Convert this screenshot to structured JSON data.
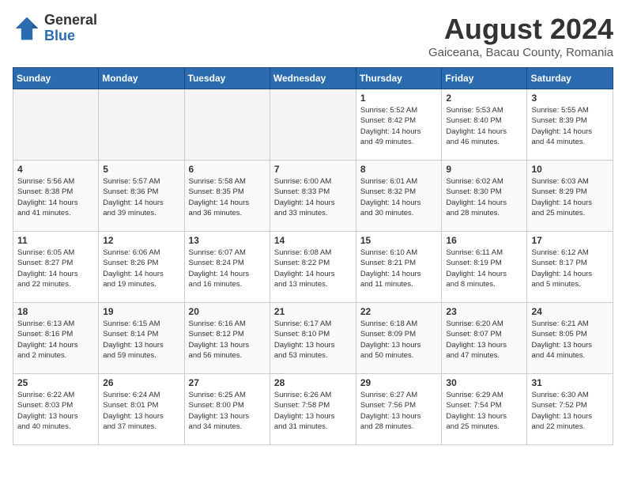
{
  "header": {
    "logo_general": "General",
    "logo_blue": "Blue",
    "month_year": "August 2024",
    "location": "Gaiceana, Bacau County, Romania"
  },
  "weekdays": [
    "Sunday",
    "Monday",
    "Tuesday",
    "Wednesday",
    "Thursday",
    "Friday",
    "Saturday"
  ],
  "weeks": [
    [
      {
        "day": "",
        "content": ""
      },
      {
        "day": "",
        "content": ""
      },
      {
        "day": "",
        "content": ""
      },
      {
        "day": "",
        "content": ""
      },
      {
        "day": "1",
        "content": "Sunrise: 5:52 AM\nSunset: 8:42 PM\nDaylight: 14 hours\nand 49 minutes."
      },
      {
        "day": "2",
        "content": "Sunrise: 5:53 AM\nSunset: 8:40 PM\nDaylight: 14 hours\nand 46 minutes."
      },
      {
        "day": "3",
        "content": "Sunrise: 5:55 AM\nSunset: 8:39 PM\nDaylight: 14 hours\nand 44 minutes."
      }
    ],
    [
      {
        "day": "4",
        "content": "Sunrise: 5:56 AM\nSunset: 8:38 PM\nDaylight: 14 hours\nand 41 minutes."
      },
      {
        "day": "5",
        "content": "Sunrise: 5:57 AM\nSunset: 8:36 PM\nDaylight: 14 hours\nand 39 minutes."
      },
      {
        "day": "6",
        "content": "Sunrise: 5:58 AM\nSunset: 8:35 PM\nDaylight: 14 hours\nand 36 minutes."
      },
      {
        "day": "7",
        "content": "Sunrise: 6:00 AM\nSunset: 8:33 PM\nDaylight: 14 hours\nand 33 minutes."
      },
      {
        "day": "8",
        "content": "Sunrise: 6:01 AM\nSunset: 8:32 PM\nDaylight: 14 hours\nand 30 minutes."
      },
      {
        "day": "9",
        "content": "Sunrise: 6:02 AM\nSunset: 8:30 PM\nDaylight: 14 hours\nand 28 minutes."
      },
      {
        "day": "10",
        "content": "Sunrise: 6:03 AM\nSunset: 8:29 PM\nDaylight: 14 hours\nand 25 minutes."
      }
    ],
    [
      {
        "day": "11",
        "content": "Sunrise: 6:05 AM\nSunset: 8:27 PM\nDaylight: 14 hours\nand 22 minutes."
      },
      {
        "day": "12",
        "content": "Sunrise: 6:06 AM\nSunset: 8:26 PM\nDaylight: 14 hours\nand 19 minutes."
      },
      {
        "day": "13",
        "content": "Sunrise: 6:07 AM\nSunset: 8:24 PM\nDaylight: 14 hours\nand 16 minutes."
      },
      {
        "day": "14",
        "content": "Sunrise: 6:08 AM\nSunset: 8:22 PM\nDaylight: 14 hours\nand 13 minutes."
      },
      {
        "day": "15",
        "content": "Sunrise: 6:10 AM\nSunset: 8:21 PM\nDaylight: 14 hours\nand 11 minutes."
      },
      {
        "day": "16",
        "content": "Sunrise: 6:11 AM\nSunset: 8:19 PM\nDaylight: 14 hours\nand 8 minutes."
      },
      {
        "day": "17",
        "content": "Sunrise: 6:12 AM\nSunset: 8:17 PM\nDaylight: 14 hours\nand 5 minutes."
      }
    ],
    [
      {
        "day": "18",
        "content": "Sunrise: 6:13 AM\nSunset: 8:16 PM\nDaylight: 14 hours\nand 2 minutes."
      },
      {
        "day": "19",
        "content": "Sunrise: 6:15 AM\nSunset: 8:14 PM\nDaylight: 13 hours\nand 59 minutes."
      },
      {
        "day": "20",
        "content": "Sunrise: 6:16 AM\nSunset: 8:12 PM\nDaylight: 13 hours\nand 56 minutes."
      },
      {
        "day": "21",
        "content": "Sunrise: 6:17 AM\nSunset: 8:10 PM\nDaylight: 13 hours\nand 53 minutes."
      },
      {
        "day": "22",
        "content": "Sunrise: 6:18 AM\nSunset: 8:09 PM\nDaylight: 13 hours\nand 50 minutes."
      },
      {
        "day": "23",
        "content": "Sunrise: 6:20 AM\nSunset: 8:07 PM\nDaylight: 13 hours\nand 47 minutes."
      },
      {
        "day": "24",
        "content": "Sunrise: 6:21 AM\nSunset: 8:05 PM\nDaylight: 13 hours\nand 44 minutes."
      }
    ],
    [
      {
        "day": "25",
        "content": "Sunrise: 6:22 AM\nSunset: 8:03 PM\nDaylight: 13 hours\nand 40 minutes."
      },
      {
        "day": "26",
        "content": "Sunrise: 6:24 AM\nSunset: 8:01 PM\nDaylight: 13 hours\nand 37 minutes."
      },
      {
        "day": "27",
        "content": "Sunrise: 6:25 AM\nSunset: 8:00 PM\nDaylight: 13 hours\nand 34 minutes."
      },
      {
        "day": "28",
        "content": "Sunrise: 6:26 AM\nSunset: 7:58 PM\nDaylight: 13 hours\nand 31 minutes."
      },
      {
        "day": "29",
        "content": "Sunrise: 6:27 AM\nSunset: 7:56 PM\nDaylight: 13 hours\nand 28 minutes."
      },
      {
        "day": "30",
        "content": "Sunrise: 6:29 AM\nSunset: 7:54 PM\nDaylight: 13 hours\nand 25 minutes."
      },
      {
        "day": "31",
        "content": "Sunrise: 6:30 AM\nSunset: 7:52 PM\nDaylight: 13 hours\nand 22 minutes."
      }
    ]
  ]
}
